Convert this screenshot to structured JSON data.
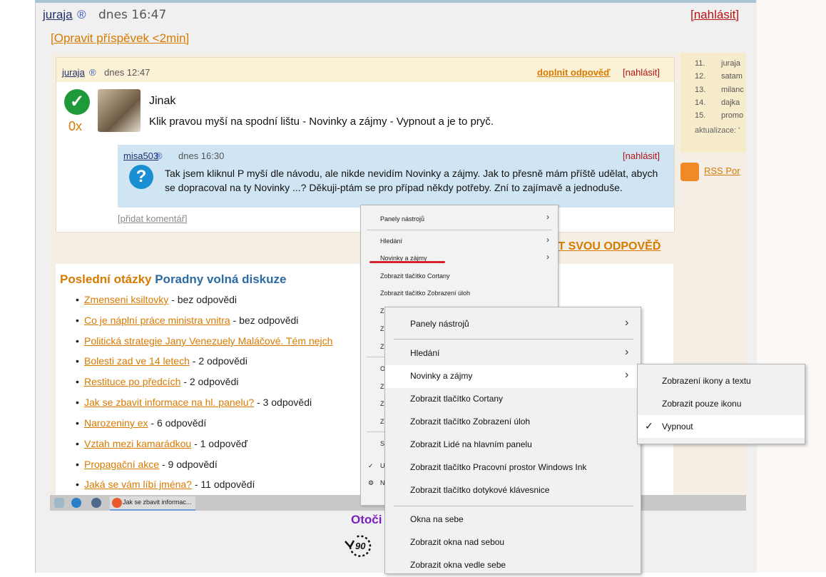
{
  "post": {
    "author": "juraja",
    "reg_mark": "®",
    "time": "dnes 16:47",
    "report": "[nahlásit]",
    "edit_link": "[Opravit příspěvek <2min]"
  },
  "screenshot": {
    "answer": {
      "user": "juraja",
      "reg_mark": "®",
      "time": "dnes 12:47",
      "complete_link": "doplnit odpověď",
      "report": "[nahlásit]",
      "score": "0x",
      "title": "Jinak",
      "text": "Klik pravou myší na spodní lištu - Novinky a zájmy - Vypnout a je to pryč."
    },
    "question": {
      "user": "misa503",
      "reg_mark": "®",
      "time": "dnes 16:30",
      "report": "[nahlásit]",
      "text": "Tak jsem kliknul P myší dle návodu, ale nikde nevidím Novinky a zájmy. Jak to přesně mám příště udělat, abych se dopracoval na ty Novinky ...? Děkuji-ptám se pro případ někdy potřeby. Zní to zajímavě a jednoduše.",
      "add_comment": "[přidat komentář]"
    },
    "your_answer": "AT SVOU ODPOVĚĎ",
    "sidebar": {
      "ranks": [
        {
          "n": "11.",
          "name": "juraja"
        },
        {
          "n": "12.",
          "name": "satam"
        },
        {
          "n": "13.",
          "name": "milanc"
        },
        {
          "n": "14.",
          "name": "dajka"
        },
        {
          "n": "15.",
          "name": "promo"
        }
      ],
      "updated": "aktualizace: '",
      "rss": "RSS Por"
    },
    "latest": {
      "title_part1": "Poslední otázky",
      "title_part2": "Poradny volná diskuze",
      "questions": [
        {
          "link": "Zmenseni ksiltovky",
          "suffix": " - bez odpovědi"
        },
        {
          "link": "Co je náplní práce ministra vnitra",
          "suffix": " - bez odpovědi"
        },
        {
          "link": "Politická strategie Jany Venezuely Maláčové. Tém nejch",
          "suffix": ""
        },
        {
          "link": "Bolesti zad ve 14 letech",
          "suffix": " - 2 odpovědi"
        },
        {
          "link": "Restituce po předcích",
          "suffix": " - 2 odpovědi"
        },
        {
          "link": "Jak se zbavit informace na hl. panelu?",
          "suffix": " - 3 odpovědi"
        },
        {
          "link": "Narozeniny ex",
          "suffix": " - 6 odpovědí"
        },
        {
          "link": "Vztah mezi kamarádkou",
          "suffix": " - 1 odpověď"
        },
        {
          "link": "Propagační akce",
          "suffix": " - 9 odpovědí"
        },
        {
          "link": "Jaká se vám líbí jména?",
          "suffix": " - 11 odpovědí"
        }
      ]
    },
    "taskbar": {
      "task_label": "Jak se zbavit informac..."
    },
    "small_menu": {
      "items": [
        "Panely nástrojů",
        "Hledání",
        "Novinky a zájmy",
        "Zobrazit tlačítko Cortany",
        "Zobrazit tlačítko Zobrazení úloh"
      ],
      "partials": [
        "Z",
        "Z",
        "Z",
        "O",
        "Z",
        "Z",
        "Z",
        "S",
        "U",
        "N"
      ]
    }
  },
  "context_menu": {
    "items": [
      {
        "label": "Panely nástrojů",
        "submenu": true
      },
      {
        "label": "Hledání",
        "submenu": true
      },
      {
        "label": "Novinky a zájmy",
        "submenu": true
      },
      {
        "label": "Zobrazit tlačítko Cortany",
        "submenu": false
      },
      {
        "label": "Zobrazit tlačítko Zobrazení úloh",
        "submenu": false
      },
      {
        "label": "Zobrazit Lidé na hlavním panelu",
        "submenu": false
      },
      {
        "label": "Zobrazit tlačítko Pracovní prostor Windows Ink",
        "submenu": false
      },
      {
        "label": "Zobrazit tlačítko dotykové klávesnice",
        "submenu": false
      },
      {
        "label": "Okna na sebe",
        "submenu": false
      },
      {
        "label": "Zobrazit okna nad sebou",
        "submenu": false
      },
      {
        "label": "Zobrazit okna vedle sebe",
        "submenu": false
      }
    ],
    "arrow_glyph": "›"
  },
  "submenu": {
    "items": [
      {
        "label": "Zobrazení ikony a textu",
        "checked": false
      },
      {
        "label": "Zobrazit pouze ikonu",
        "checked": false
      },
      {
        "label": "Vypnout",
        "checked": true
      }
    ],
    "check_glyph": "✓"
  },
  "rotate": {
    "label": "Otoči",
    "badge": "90"
  },
  "colors": {
    "orange": "#d77a00",
    "report_red": "#b31313",
    "purple": "#7a1fbf"
  }
}
